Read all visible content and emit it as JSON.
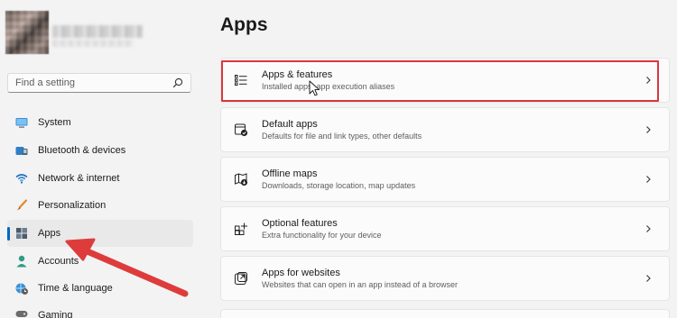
{
  "sidebar": {
    "search": {
      "placeholder": "Find a setting"
    },
    "items": [
      {
        "label": "System",
        "icon": "monitor-icon",
        "active": false
      },
      {
        "label": "Bluetooth & devices",
        "icon": "bluetooth-icon",
        "active": false
      },
      {
        "label": "Network & internet",
        "icon": "wifi-icon",
        "active": false
      },
      {
        "label": "Personalization",
        "icon": "paintbrush-icon",
        "active": false
      },
      {
        "label": "Apps",
        "icon": "apps-icon",
        "active": true
      },
      {
        "label": "Accounts",
        "icon": "person-icon",
        "active": false
      },
      {
        "label": "Time & language",
        "icon": "globe-clock-icon",
        "active": false
      },
      {
        "label": "Gaming",
        "icon": "gamepad-icon",
        "active": false
      }
    ]
  },
  "main": {
    "title": "Apps",
    "cards": [
      {
        "title": "Apps & features",
        "subtitle": "Installed apps, app execution aliases",
        "icon": "list-icon",
        "highlighted": true
      },
      {
        "title": "Default apps",
        "subtitle": "Defaults for file and link types, other defaults",
        "icon": "default-apps-icon"
      },
      {
        "title": "Offline maps",
        "subtitle": "Downloads, storage location, map updates",
        "icon": "map-icon"
      },
      {
        "title": "Optional features",
        "subtitle": "Extra functionality for your device",
        "icon": "optional-features-icon"
      },
      {
        "title": "Apps for websites",
        "subtitle": "Websites that can open in an app instead of a browser",
        "icon": "open-external-icon"
      }
    ]
  },
  "colors": {
    "accent": "#0067c0",
    "annotation": "#d9363e",
    "background": "#f3f3f3",
    "card": "#fbfbfb"
  }
}
